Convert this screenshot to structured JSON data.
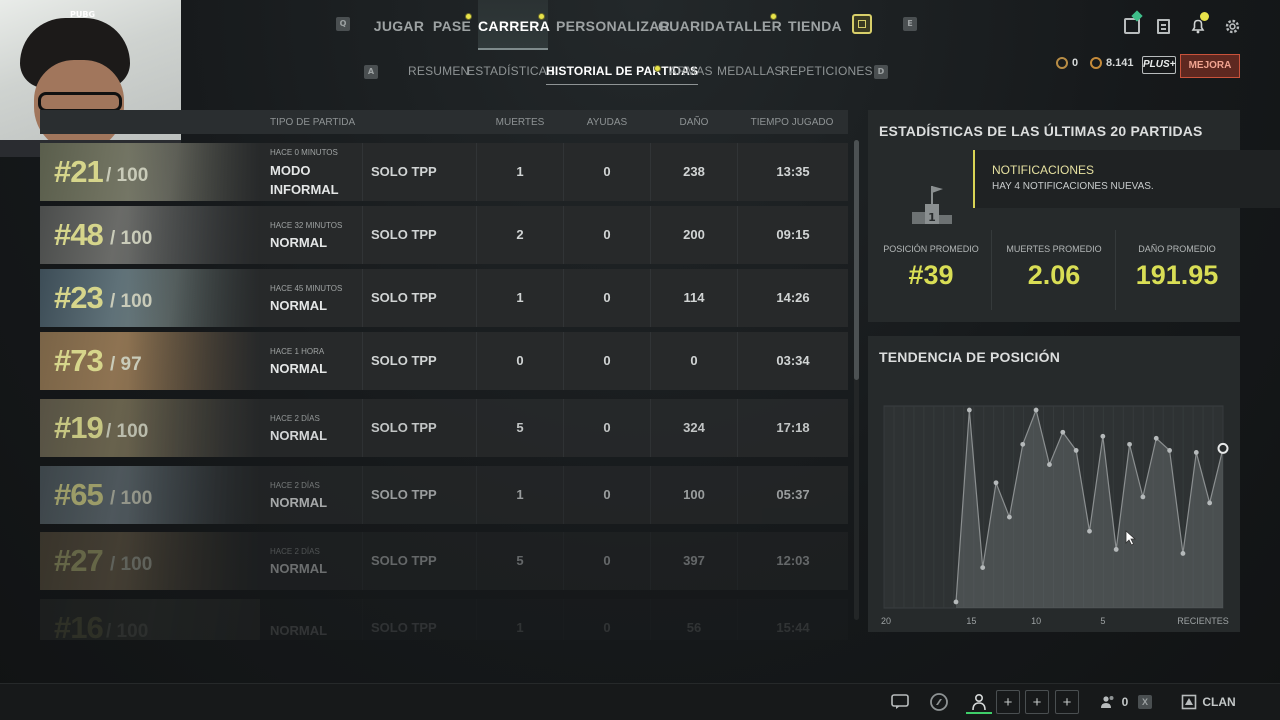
{
  "webcam": {
    "overlay_label": "PUBG"
  },
  "topnav": {
    "left_key": "Q",
    "right_key": "E",
    "items": [
      {
        "label": "JUGAR"
      },
      {
        "label": "PASE"
      },
      {
        "label": "CARRERA"
      },
      {
        "label": "PERSONALIZAR"
      },
      {
        "label": "GUARIDA"
      },
      {
        "label": "TALLER"
      },
      {
        "label": "TIENDA"
      }
    ],
    "active": "CARRERA"
  },
  "subnav": {
    "left_key": "A",
    "right_key": "D",
    "items": [
      {
        "label": "RESUMEN"
      },
      {
        "label": "ESTADÍSTICAS"
      },
      {
        "label": "HISTORIAL DE PARTIDAS"
      },
      {
        "label": "ARMAS"
      },
      {
        "label": "MEDALLAS"
      },
      {
        "label": "REPETICIONES"
      }
    ],
    "active": "HISTORIAL DE PARTIDAS"
  },
  "currency": {
    "coin_a": "0",
    "coin_b": "8.141",
    "plus_label": "PLUS+",
    "upgrade_label": "MEJORA"
  },
  "table": {
    "headers": {
      "type": "TIPO DE PARTIDA",
      "kills": "MUERTES",
      "assists": "AYUDAS",
      "damage": "DAÑO",
      "time": "TIEMPO JUGADO"
    },
    "rows": [
      {
        "rank": "#21",
        "of": "/ 100",
        "when": "HACE 0 MINUTOS",
        "mode": "MODO INFORMAL",
        "type": "SOLO TPP",
        "kills": "1",
        "assists": "0",
        "damage": "238",
        "time": "13:35"
      },
      {
        "rank": "#48",
        "of": "/ 100",
        "when": "HACE 32 MINUTOS",
        "mode": "NORMAL",
        "type": "SOLO TPP",
        "kills": "2",
        "assists": "0",
        "damage": "200",
        "time": "09:15"
      },
      {
        "rank": "#23",
        "of": "/ 100",
        "when": "HACE 45 MINUTOS",
        "mode": "NORMAL",
        "type": "SOLO TPP",
        "kills": "1",
        "assists": "0",
        "damage": "114",
        "time": "14:26"
      },
      {
        "rank": "#73",
        "of": "/ 97",
        "when": "HACE 1 HORA",
        "mode": "NORMAL",
        "type": "SOLO TPP",
        "kills": "0",
        "assists": "0",
        "damage": "0",
        "time": "03:34"
      },
      {
        "rank": "#19",
        "of": "/ 100",
        "when": "HACE 2 DÍAS",
        "mode": "NORMAL",
        "type": "SOLO TPP",
        "kills": "5",
        "assists": "0",
        "damage": "324",
        "time": "17:18"
      },
      {
        "rank": "#65",
        "of": "/ 100",
        "when": "HACE 2 DÍAS",
        "mode": "NORMAL",
        "type": "SOLO TPP",
        "kills": "1",
        "assists": "0",
        "damage": "100",
        "time": "05:37"
      },
      {
        "rank": "#27",
        "of": "/ 100",
        "when": "HACE 2 DÍAS",
        "mode": "NORMAL",
        "type": "SOLO TPP",
        "kills": "5",
        "assists": "0",
        "damage": "397",
        "time": "12:03"
      },
      {
        "rank": "#16",
        "of": "/ 100",
        "when": "",
        "mode": "NORMAL",
        "type": "SOLO TPP",
        "kills": "1",
        "assists": "0",
        "damage": "56",
        "time": "15:44"
      }
    ]
  },
  "stats": {
    "title": "ESTADÍSTICAS DE LAS ÚLTIMAS 20 PARTIDAS",
    "avg_position_label": "POSICIÓN PROMEDIO",
    "avg_position": "#39",
    "avg_kills_label": "MUERTES PROMEDIO",
    "avg_kills": "2.06",
    "avg_damage_label": "DAÑO PROMEDIO",
    "avg_damage": "191.95"
  },
  "notification": {
    "title": "NOTIFICACIONES",
    "message": "HAY 4 NOTIFICACIONES NUEVAS."
  },
  "trend": {
    "title": "TENDENCIA DE POSICIÓN",
    "tick_labels": [
      "20",
      "15",
      "10",
      "5",
      "RECIENTES"
    ]
  },
  "chart_data": {
    "type": "area",
    "title": "TENDENCIA DE POSICIÓN",
    "xlabel": "",
    "ylabel": "",
    "x_ticks": [
      "20",
      "15",
      "10",
      "5",
      "RECIENTES"
    ],
    "x": [
      20,
      19,
      18,
      17,
      16,
      15,
      14,
      13,
      12,
      11,
      10,
      9,
      8,
      7,
      6,
      5,
      4,
      3,
      2,
      1
    ],
    "y_inverted": true,
    "series": [
      {
        "values": [
          97,
          2,
          80,
          38,
          55,
          19,
          2,
          29,
          13,
          22,
          62,
          15,
          71,
          19,
          45,
          16,
          22,
          73,
          23,
          48,
          21
        ]
      }
    ],
    "accent_color": "#8b8f90"
  },
  "bottombar": {
    "count": "0",
    "clan_label": "CLAN"
  }
}
